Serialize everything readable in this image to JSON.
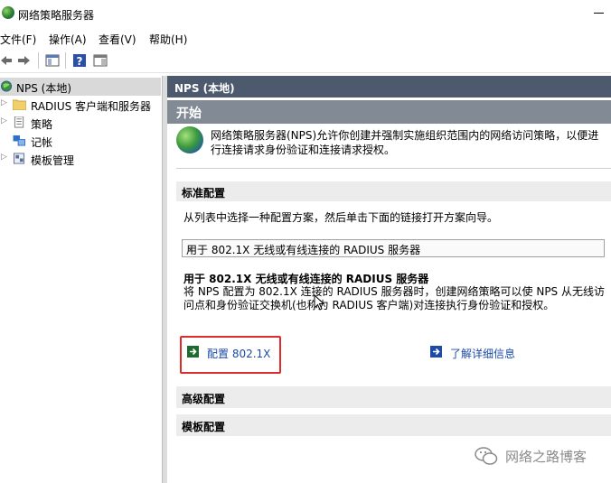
{
  "window": {
    "title": "网络策略服务器"
  },
  "menu": [
    "文件(F)",
    "操作(A)",
    "查看(V)",
    "帮助(H)"
  ],
  "toolbar": {
    "buttons": [
      "back-icon",
      "forward-icon",
      "show-hide-tree-icon",
      "help-icon",
      "properties-icon"
    ]
  },
  "tree": {
    "root": "NPS (本地)",
    "items": [
      {
        "label": "RADIUS 客户端和服务器",
        "icon": "folder-icon"
      },
      {
        "label": "策略",
        "icon": "policy-icon"
      },
      {
        "label": "记帐",
        "icon": "accounting-icon"
      },
      {
        "label": "模板管理",
        "icon": "templates-icon"
      }
    ]
  },
  "content": {
    "header": "NPS (本地)",
    "start": "开始",
    "intro": "网络策略服务器(NPS)允许你创建并强制实施组织范围内的网络访问策略，以便进行连接请求身份验证和连接请求授权。",
    "standard_config": {
      "title": "标准配置",
      "desc": "从列表中选择一种配置方案，然后单击下面的链接打开方案向导。",
      "selected_option": "用于 802.1X 无线或有线连接的 RADIUS 服务器",
      "option_title": "用于 802.1X 无线或有线连接的 RADIUS 服务器",
      "option_desc": "将 NPS 配置为 802.1X 连接的 RADIUS 服务器时，创建网络策略可以使 NPS 从无线访问点和身份验证交换机(也称为 RADIUS 客户端)对连接执行身份验证和授权。",
      "configure_link": "配置 802.1X",
      "learn_more_link": "了解详细信息"
    },
    "advanced_config": "高级配置",
    "template_config": "模板配置"
  },
  "watermark": "网络之路博客",
  "colors": {
    "content_header": "#4d5a6e",
    "start_header": "#828a96",
    "highlight": "#e02b2b",
    "link": "#1a4aa8"
  }
}
